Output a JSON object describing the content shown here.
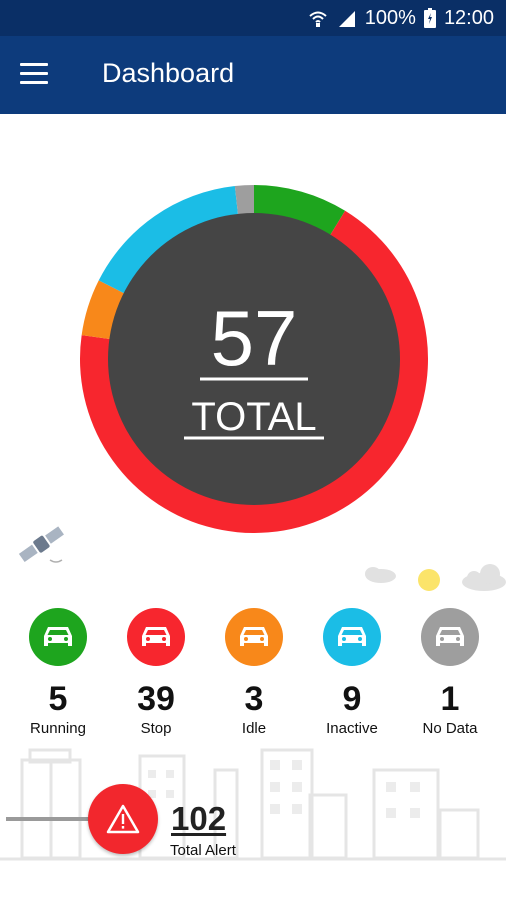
{
  "status_bar": {
    "battery": "100%",
    "time": "12:00"
  },
  "app_bar": {
    "title": "Dashboard"
  },
  "summary": {
    "total": "57",
    "total_label": "TOTAL",
    "segments": [
      {
        "name": "Running",
        "value": 5,
        "color": "#1ea51e"
      },
      {
        "name": "Stop",
        "value": 39,
        "color": "#f7262e"
      },
      {
        "name": "Idle",
        "value": 3,
        "color": "#f8881a"
      },
      {
        "name": "Inactive",
        "value": 9,
        "color": "#1bbde6"
      },
      {
        "name": "No Data",
        "value": 1,
        "color": "#9e9e9e"
      }
    ],
    "center_color": "#454545"
  },
  "categories": [
    {
      "count": "5",
      "label": "Running",
      "color": "#1ea51e"
    },
    {
      "count": "39",
      "label": "Stop",
      "color": "#f7262e"
    },
    {
      "count": "3",
      "label": "Idle",
      "color": "#f8881a"
    },
    {
      "count": "9",
      "label": "Inactive",
      "color": "#1bbde6"
    },
    {
      "count": "1",
      "label": "No Data",
      "color": "#9e9e9e"
    }
  ],
  "alerts": {
    "count": "102",
    "label": "Total Alert",
    "color": "#f2272d"
  },
  "icons": {
    "menu": "menu-icon",
    "wifi": "wifi-icon",
    "signal": "signal-icon",
    "battery": "battery-icon",
    "car": "car-icon",
    "warning": "warning-icon",
    "satellite": "satellite-icon"
  }
}
